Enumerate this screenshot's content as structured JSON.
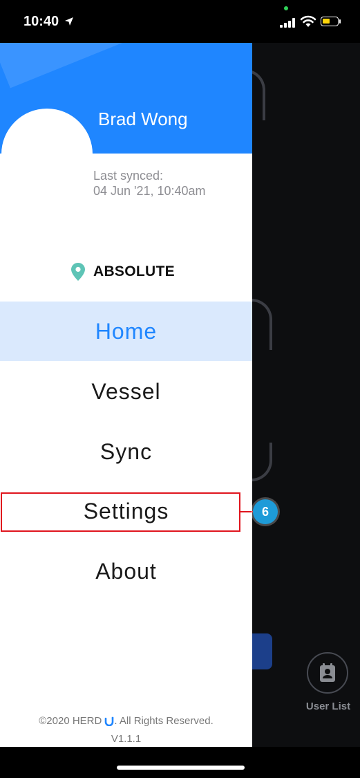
{
  "status_bar": {
    "time": "10:40",
    "battery_level": 0.45,
    "colors": {
      "battery": "#ffd60a",
      "privacy_dot": "#30d158"
    }
  },
  "drawer": {
    "user_name": "Brad Wong",
    "last_synced_label": "Last synced:",
    "last_synced_value": "04 Jun '21, 10:40am",
    "organization": "ABSOLUTE",
    "location_icon": "location-pin-icon",
    "menu": [
      {
        "label": "Home",
        "active": true
      },
      {
        "label": "Vessel",
        "active": false
      },
      {
        "label": "Sync",
        "active": false
      },
      {
        "label": "Settings",
        "active": false
      },
      {
        "label": "About",
        "active": false
      }
    ],
    "footer": {
      "copyright_pre": "©2020 HERD",
      "copyright_post": ". All Rights Reserved.",
      "version": "V1.1.1"
    },
    "colors": {
      "header": "#1f86ff",
      "active_bg": "#dae9fd",
      "pin": "#5ec4b6"
    }
  },
  "background": {
    "user_list_label": "User List"
  },
  "annotation": {
    "badge_number": "6",
    "colors": {
      "box": "#e0141d",
      "badge": "#1e9bd8"
    }
  }
}
